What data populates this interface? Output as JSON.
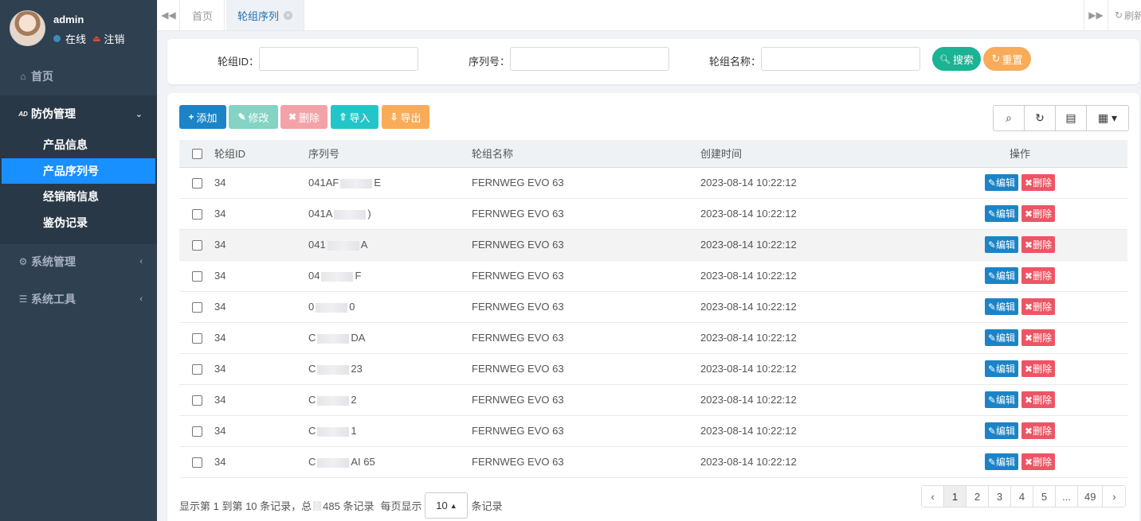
{
  "user": {
    "name": "admin",
    "status": "在线",
    "logout": "注销"
  },
  "sidebar": {
    "home": "首页",
    "group": {
      "label": "防伪管理",
      "items": [
        {
          "label": "产品信息"
        },
        {
          "label": "产品序列号"
        },
        {
          "label": "经销商信息"
        },
        {
          "label": "鉴伪记录"
        }
      ]
    },
    "system": "系统管理",
    "tools": "系统工具"
  },
  "tabs": [
    {
      "label": "首页"
    },
    {
      "label": "轮组序列"
    }
  ],
  "tab_refresh": "刷新",
  "search": {
    "group_id_label": "轮组ID：",
    "serial_label": "序列号：",
    "group_name_label": "轮组名称：",
    "search_btn": "搜索",
    "reset_btn": "重置"
  },
  "toolbar": {
    "add": "添加",
    "edit": "修改",
    "delete": "删除",
    "import": "导入",
    "export": "导出"
  },
  "table": {
    "headers": [
      "轮组ID",
      "序列号",
      "轮组名称",
      "创建时间",
      "操作"
    ],
    "rows": [
      {
        "id": "34",
        "serial_a": "041AF",
        "serial_b": "E",
        "name": "FERNWEG EVO 63",
        "time": "2023-08-14 10:22:12"
      },
      {
        "id": "34",
        "serial_a": "041A",
        "serial_b": ")",
        "name": "FERNWEG EVO 63",
        "time": "2023-08-14 10:22:12"
      },
      {
        "id": "34",
        "serial_a": "041",
        "serial_b": "A",
        "name": "FERNWEG EVO 63",
        "time": "2023-08-14 10:22:12"
      },
      {
        "id": "34",
        "serial_a": "04",
        "serial_b": "F",
        "name": "FERNWEG EVO 63",
        "time": "2023-08-14 10:22:12"
      },
      {
        "id": "34",
        "serial_a": "0",
        "serial_b": "0",
        "name": "FERNWEG EVO 63",
        "time": "2023-08-14 10:22:12"
      },
      {
        "id": "34",
        "serial_a": "C",
        "serial_b": "DA",
        "name": "FERNWEG EVO 63",
        "time": "2023-08-14 10:22:12"
      },
      {
        "id": "34",
        "serial_a": "C",
        "serial_b": "23",
        "name": "FERNWEG EVO 63",
        "time": "2023-08-14 10:22:12"
      },
      {
        "id": "34",
        "serial_a": "C",
        "serial_b": "2",
        "name": "FERNWEG EVO 63",
        "time": "2023-08-14 10:22:12"
      },
      {
        "id": "34",
        "serial_a": "C",
        "serial_b": "1",
        "name": "FERNWEG EVO 63",
        "time": "2023-08-14 10:22:12"
      },
      {
        "id": "34",
        "serial_a": "C",
        "serial_b": "AI 65",
        "name": "FERNWEG EVO 63",
        "time": "2023-08-14 10:22:12"
      }
    ],
    "row_edit": "编辑",
    "row_delete": "删除"
  },
  "pager": {
    "info_prefix": "显示第 1 到第 10 条记录，总",
    "info_total": "485 条记录",
    "per_page_label": "每页显示",
    "page_size": "10",
    "per_page_suffix": "条记录",
    "pages": [
      "‹",
      "1",
      "2",
      "3",
      "4",
      "5",
      "...",
      "49",
      "›"
    ],
    "current": "1"
  },
  "colors": {
    "sidebar_bg": "#2f4050",
    "active_menu": "#1890ff",
    "primary": "#1c84c6",
    "success": "#1ab394",
    "warning": "#f8ac59",
    "danger": "#ed5565",
    "info": "#23c6c8"
  }
}
